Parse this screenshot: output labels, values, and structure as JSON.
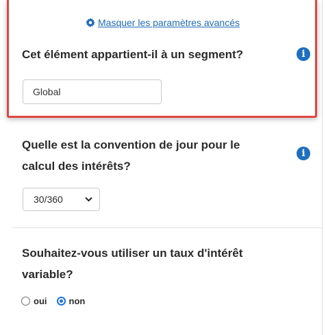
{
  "advanced": {
    "link_label": "Masquer les paramètres avancés",
    "icon": "gear-icon"
  },
  "segment": {
    "question": "Cet élément appartient-il à un segment?",
    "value": "Global",
    "info_icon": "info-icon"
  },
  "day_convention": {
    "question_line1": "Quelle est la convention de jour pour le",
    "question_line2": "calcul des intérêts?",
    "selected": "30/360",
    "info_icon": "info-icon"
  },
  "variable_rate": {
    "question_line1": "Souhaitez-vous utiliser un taux d'intérêt",
    "question_line2": "variable?",
    "options": [
      {
        "label": "oui",
        "checked": false
      },
      {
        "label": "non",
        "checked": true
      }
    ]
  },
  "colors": {
    "highlight_border": "#e0463f",
    "link": "#1f6bb8",
    "info_icon": "#1e6fbf",
    "radio_checked": "#1a73e8"
  }
}
